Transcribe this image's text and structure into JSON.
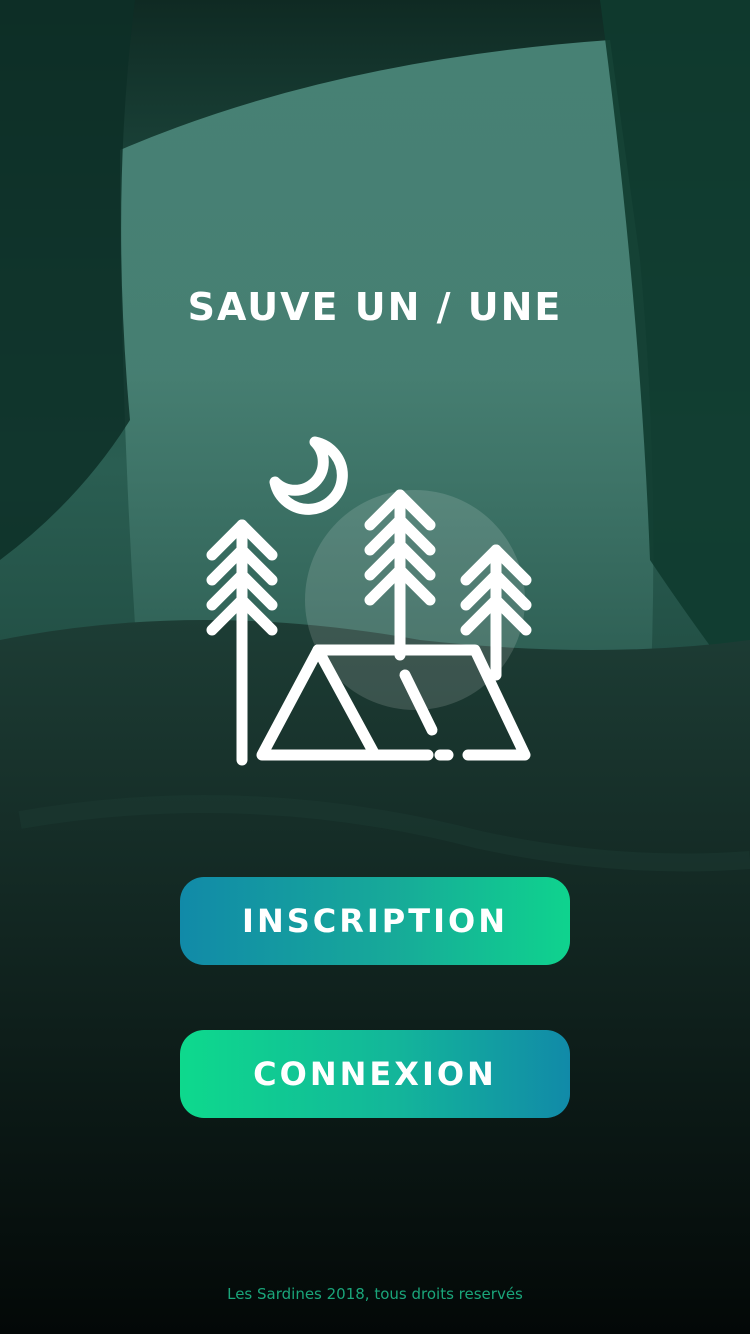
{
  "screen": {
    "title": "SAUVE UN / UNE",
    "logo_icon": "camping-tent-trees-moon-icon"
  },
  "actions": {
    "signup_label": "INSCRIPTION",
    "login_label": "CONNEXION"
  },
  "footer": {
    "copyright": "Les Sardines 2018, tous droits reservés"
  },
  "colors": {
    "accent_blue": "#118aa8",
    "accent_green": "#0fd38e",
    "footer_text": "#1aa57a"
  }
}
